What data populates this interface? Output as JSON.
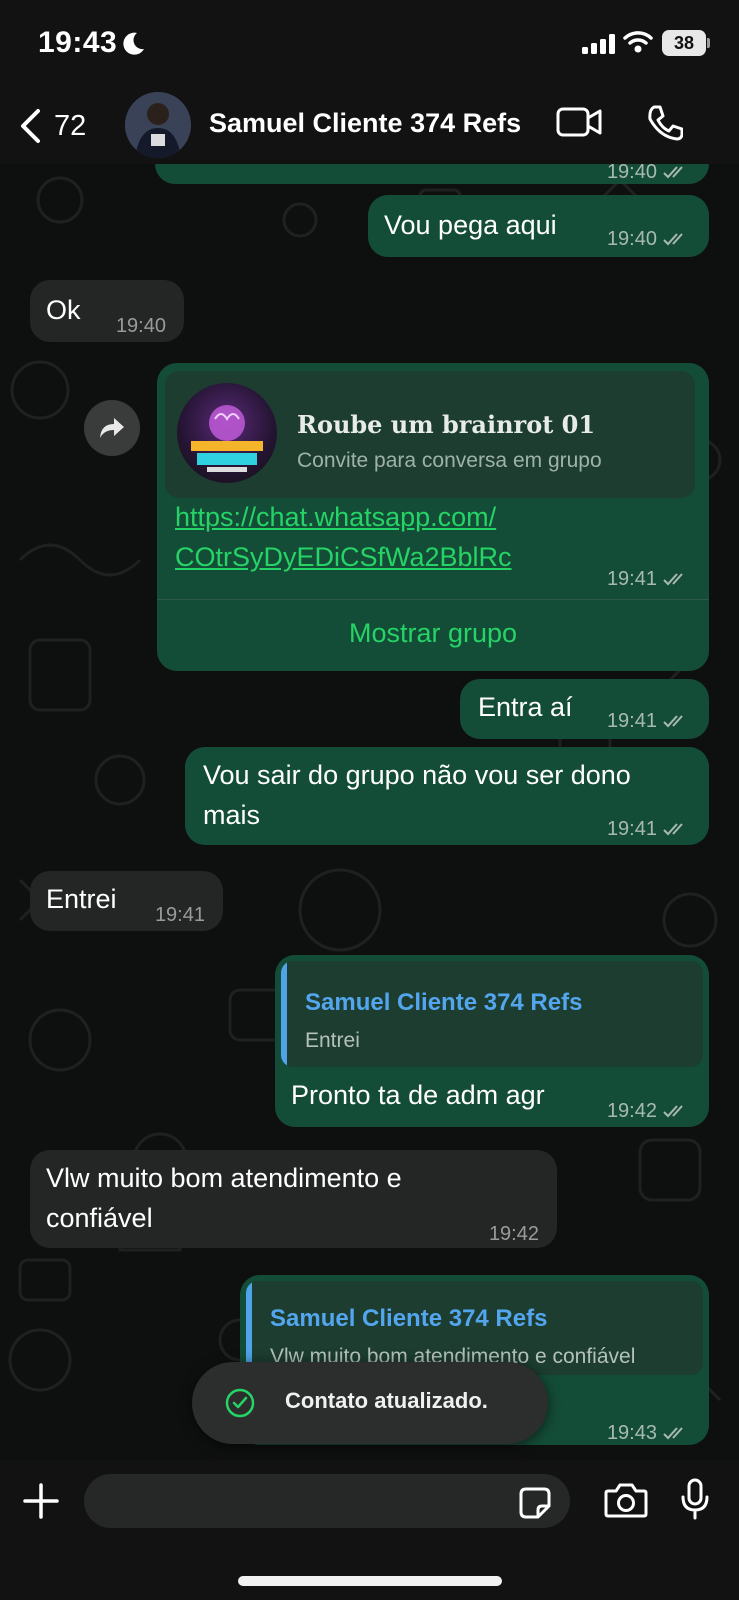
{
  "status_bar": {
    "time": "19:43",
    "battery": "38"
  },
  "header": {
    "back_count": "72",
    "contact_name": "Samuel Cliente 374 Refs"
  },
  "messages": [
    {
      "time": "19:40"
    },
    {
      "text": "Vou pega aqui",
      "time": "19:40"
    },
    {
      "text": "Ok",
      "time": "19:40"
    },
    {
      "group_name": "Roube um brainrot 01",
      "subtitle": "Convite para conversa em grupo",
      "link_line1": "https://chat.whatsapp.com/",
      "link_line2": "COtrSyDyEDiCSfWa2BblRc",
      "time": "19:41",
      "action": "Mostrar grupo"
    },
    {
      "text": "Entra aí",
      "time": "19:41"
    },
    {
      "text_line1": "Vou sair do grupo não vou ser dono",
      "text_line2": "mais",
      "time": "19:41"
    },
    {
      "text": "Entrei",
      "time": "19:41"
    },
    {
      "quote_name": "Samuel Cliente 374 Refs",
      "quote_text": "Entrei",
      "text": "Pronto ta de adm agr",
      "time": "19:42"
    },
    {
      "text_line1": "Vlw muito bom atendimento e",
      "text_line2": "confiável",
      "time": "19:42"
    },
    {
      "quote_name": "Samuel Cliente 374 Refs",
      "quote_text": "Vlw muito bom atendimento e confiável",
      "time": "19:43"
    }
  ],
  "toast": {
    "text": "Contato atualizado."
  },
  "input": {
    "placeholder": ""
  },
  "colors": {
    "outgoing_bubble": "#144d37",
    "incoming_bubble": "#242626",
    "accent_green": "#26d366",
    "quote_blue": "#53a6ee"
  },
  "icons": [
    "moon-icon",
    "signal-icon",
    "wifi-icon",
    "back-chevron-icon",
    "video-call-icon",
    "phone-icon",
    "forward-icon",
    "double-check-icon",
    "check-circle-icon",
    "plus-icon",
    "sticker-icon",
    "camera-icon",
    "mic-icon"
  ]
}
